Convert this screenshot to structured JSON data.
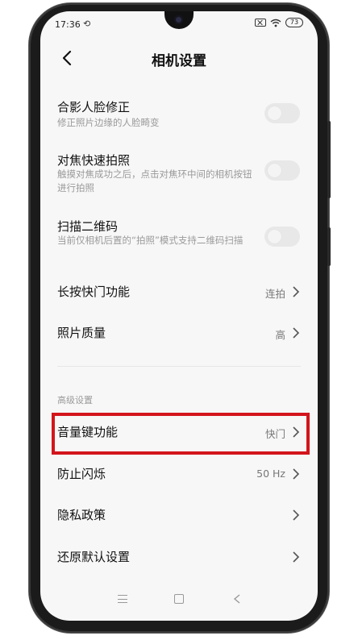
{
  "status_bar": {
    "time": "17:36",
    "sync_glyph": "⟲",
    "battery": "73"
  },
  "header": {
    "title": "相机设置"
  },
  "settings": [
    {
      "label": "合影人脸修正",
      "desc": "修正照片边缘的人脸畸变",
      "control": "toggle",
      "on": false
    },
    {
      "label": "对焦快速拍照",
      "desc": "触摸对焦成功之后，点击对焦环中间的相机按钮进行拍照",
      "control": "toggle",
      "on": false
    },
    {
      "label": "扫描二维码",
      "desc": "当前仅相机后置的“拍照”模式支持二维码扫描",
      "control": "toggle",
      "on": false
    },
    {
      "label": "长按快门功能",
      "value": "连拍",
      "control": "chevron"
    },
    {
      "label": "照片质量",
      "value": "高",
      "control": "chevron"
    }
  ],
  "section_title": "高级设置",
  "advanced": [
    {
      "label": "音量键功能",
      "value": "快门",
      "control": "chevron"
    },
    {
      "label": "防止闪烁",
      "value": "50 Hz",
      "control": "chevron"
    },
    {
      "label": "隐私政策",
      "value": "",
      "control": "chevron"
    },
    {
      "label": "还原默认设置",
      "value": "",
      "control": "chevron"
    }
  ],
  "colors": {
    "highlight": "#d3151c",
    "toggle_off": "#e8e8e8",
    "background": "#f7f7f7"
  },
  "icons": {
    "back": "chevron-left-icon",
    "nav": [
      "menu-icon",
      "home-icon",
      "back-triangle-icon"
    ]
  }
}
